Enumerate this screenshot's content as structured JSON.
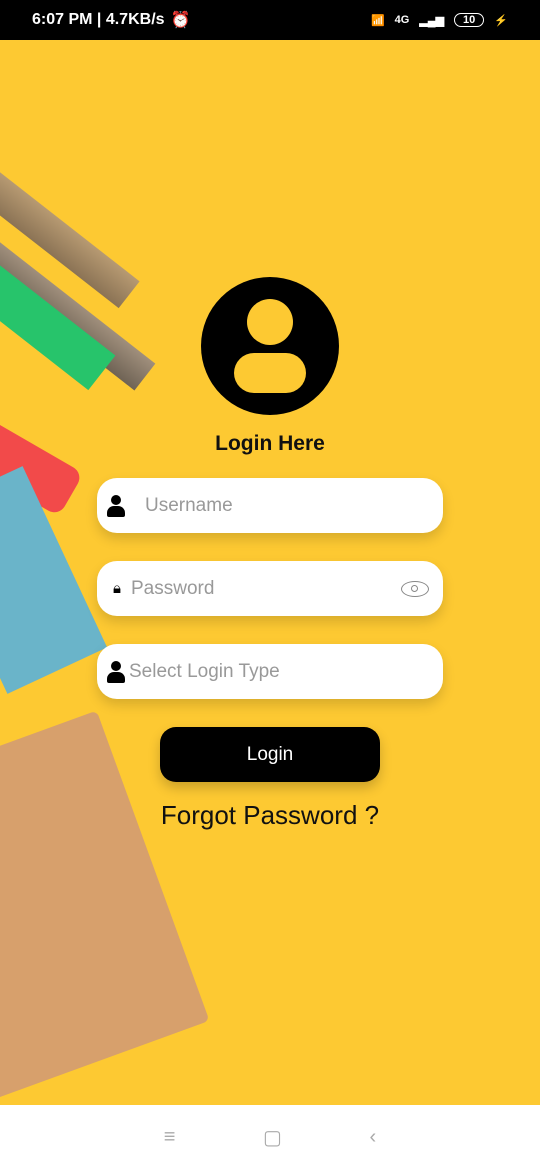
{
  "status_bar": {
    "time": "6:07 PM | 4.7KB/s",
    "battery": "10",
    "network": "4G"
  },
  "login": {
    "title": "Login Here",
    "username_placeholder": "Username",
    "password_placeholder": "Password",
    "login_type_placeholder": "Select Login Type",
    "login_button": "Login",
    "forgot_password": "Forgot Password ?"
  },
  "icons": {
    "avatar": "user-circle-icon",
    "username": "user-icon",
    "password": "lock-icon",
    "toggle": "eye-icon",
    "login_type": "user-icon"
  },
  "colors": {
    "background": "#fdc932",
    "button": "#000000"
  },
  "nav": {
    "menu": "≡",
    "home": "▢",
    "back": "‹"
  }
}
